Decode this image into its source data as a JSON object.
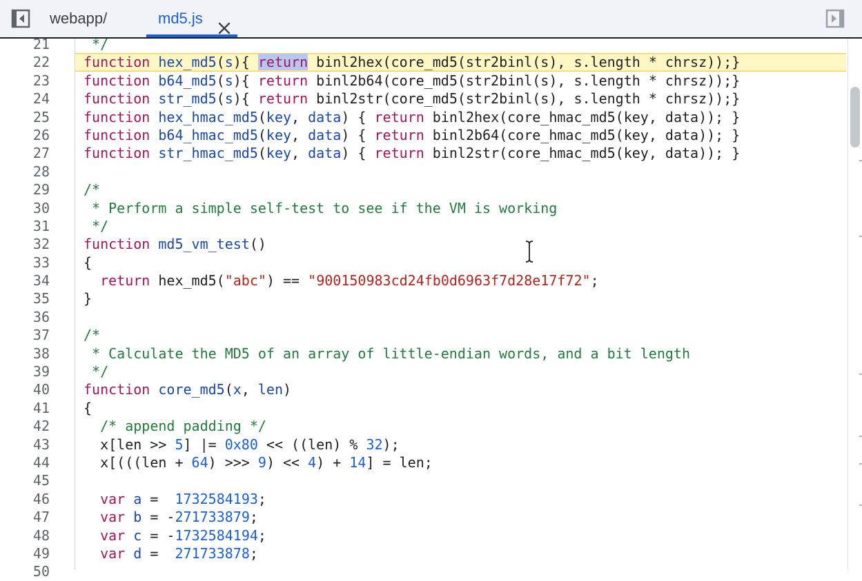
{
  "tabs": [
    {
      "label": "webapp/",
      "active": false
    },
    {
      "label": "md5.js",
      "active": true
    }
  ],
  "icons": {
    "left_toggle": "panel-left-collapse-icon",
    "right_toggle": "panel-right-expand-icon",
    "tab_close": "close-icon",
    "cursor": "text-cursor-icon"
  },
  "colors": {
    "keyword": "#a3155b",
    "function_name": "#1a47a3",
    "comment": "#237a3e",
    "string": "#b3241b",
    "number": "#1a5fd6",
    "current_line_bg": "#fff8c5",
    "selection_bg": "#b7c7ef",
    "active_tab": "#1a5fd6"
  },
  "editor": {
    "current_line": 22,
    "lines": [
      {
        "n": "21",
        "tokens": [
          [
            " */",
            "c"
          ]
        ]
      },
      {
        "n": "22",
        "tokens": [
          [
            "function",
            "k"
          ],
          [
            " ",
            "p"
          ],
          [
            "hex_md5",
            "f"
          ],
          [
            "(",
            "p"
          ],
          [
            "s",
            "f"
          ],
          [
            "){ ",
            "p"
          ],
          [
            "return",
            "sel"
          ],
          [
            " binl2hex(core_md5(str2binl(s), s.length * chrsz));}",
            "p"
          ]
        ]
      },
      {
        "n": "23",
        "tokens": [
          [
            "function",
            "k"
          ],
          [
            " ",
            "p"
          ],
          [
            "b64_md5",
            "f"
          ],
          [
            "(",
            "p"
          ],
          [
            "s",
            "f"
          ],
          [
            "){ ",
            "p"
          ],
          [
            "return",
            "k"
          ],
          [
            " binl2b64(core_md5(str2binl(s), s.length * chrsz));}",
            "p"
          ]
        ]
      },
      {
        "n": "24",
        "tokens": [
          [
            "function",
            "k"
          ],
          [
            " ",
            "p"
          ],
          [
            "str_md5",
            "f"
          ],
          [
            "(",
            "p"
          ],
          [
            "s",
            "f"
          ],
          [
            "){ ",
            "p"
          ],
          [
            "return",
            "k"
          ],
          [
            " binl2str(core_md5(str2binl(s), s.length * chrsz));}",
            "p"
          ]
        ]
      },
      {
        "n": "25",
        "tokens": [
          [
            "function",
            "k"
          ],
          [
            " ",
            "p"
          ],
          [
            "hex_hmac_md5",
            "f"
          ],
          [
            "(",
            "p"
          ],
          [
            "key",
            "f"
          ],
          [
            ", ",
            "p"
          ],
          [
            "data",
            "f"
          ],
          [
            ") { ",
            "p"
          ],
          [
            "return",
            "k"
          ],
          [
            " binl2hex(core_hmac_md5(key, data)); }",
            "p"
          ]
        ]
      },
      {
        "n": "26",
        "tokens": [
          [
            "function",
            "k"
          ],
          [
            " ",
            "p"
          ],
          [
            "b64_hmac_md5",
            "f"
          ],
          [
            "(",
            "p"
          ],
          [
            "key",
            "f"
          ],
          [
            ", ",
            "p"
          ],
          [
            "data",
            "f"
          ],
          [
            ") { ",
            "p"
          ],
          [
            "return",
            "k"
          ],
          [
            " binl2b64(core_hmac_md5(key, data)); }",
            "p"
          ]
        ]
      },
      {
        "n": "27",
        "tokens": [
          [
            "function",
            "k"
          ],
          [
            " ",
            "p"
          ],
          [
            "str_hmac_md5",
            "f"
          ],
          [
            "(",
            "p"
          ],
          [
            "key",
            "f"
          ],
          [
            ", ",
            "p"
          ],
          [
            "data",
            "f"
          ],
          [
            ") { ",
            "p"
          ],
          [
            "return",
            "k"
          ],
          [
            " binl2str(core_hmac_md5(key, data)); }",
            "p"
          ]
        ]
      },
      {
        "n": "28",
        "tokens": []
      },
      {
        "n": "29",
        "tokens": [
          [
            "/*",
            "c"
          ]
        ]
      },
      {
        "n": "30",
        "tokens": [
          [
            " * Perform a simple self-test to see if the VM is working",
            "c"
          ]
        ]
      },
      {
        "n": "31",
        "tokens": [
          [
            " */",
            "c"
          ]
        ]
      },
      {
        "n": "32",
        "tokens": [
          [
            "function",
            "k"
          ],
          [
            " ",
            "p"
          ],
          [
            "md5_vm_test",
            "f"
          ],
          [
            "()",
            "p"
          ]
        ]
      },
      {
        "n": "33",
        "tokens": [
          [
            "{",
            "p"
          ]
        ]
      },
      {
        "n": "34",
        "tokens": [
          [
            "  ",
            "p"
          ],
          [
            "return",
            "k"
          ],
          [
            " hex_md5(",
            "p"
          ],
          [
            "\"abc\"",
            "s"
          ],
          [
            ") == ",
            "p"
          ],
          [
            "\"900150983cd24fb0d6963f7d28e17f72\"",
            "s"
          ],
          [
            ";",
            "p"
          ]
        ]
      },
      {
        "n": "35",
        "tokens": [
          [
            "}",
            "p"
          ]
        ]
      },
      {
        "n": "36",
        "tokens": []
      },
      {
        "n": "37",
        "tokens": [
          [
            "/*",
            "c"
          ]
        ]
      },
      {
        "n": "38",
        "tokens": [
          [
            " * Calculate the MD5 of an array of little-endian words, and a bit length",
            "c"
          ]
        ]
      },
      {
        "n": "39",
        "tokens": [
          [
            " */",
            "c"
          ]
        ]
      },
      {
        "n": "40",
        "tokens": [
          [
            "function",
            "k"
          ],
          [
            " ",
            "p"
          ],
          [
            "core_md5",
            "f"
          ],
          [
            "(",
            "p"
          ],
          [
            "x",
            "f"
          ],
          [
            ", ",
            "p"
          ],
          [
            "len",
            "f"
          ],
          [
            ")",
            "p"
          ]
        ]
      },
      {
        "n": "41",
        "tokens": [
          [
            "{",
            "p"
          ]
        ]
      },
      {
        "n": "42",
        "tokens": [
          [
            "  ",
            "p"
          ],
          [
            "/* append padding */",
            "c"
          ]
        ]
      },
      {
        "n": "43",
        "tokens": [
          [
            "  x[len >> ",
            "p"
          ],
          [
            "5",
            "n"
          ],
          [
            "] |= ",
            "p"
          ],
          [
            "0x80",
            "n"
          ],
          [
            " << ((len) % ",
            "p"
          ],
          [
            "32",
            "n"
          ],
          [
            ");",
            "p"
          ]
        ]
      },
      {
        "n": "44",
        "tokens": [
          [
            "  x[(((len + ",
            "p"
          ],
          [
            "64",
            "n"
          ],
          [
            ") >>> ",
            "p"
          ],
          [
            "9",
            "n"
          ],
          [
            ") << ",
            "p"
          ],
          [
            "4",
            "n"
          ],
          [
            ") + ",
            "p"
          ],
          [
            "14",
            "n"
          ],
          [
            "] = len;",
            "p"
          ]
        ]
      },
      {
        "n": "45",
        "tokens": []
      },
      {
        "n": "46",
        "tokens": [
          [
            "  ",
            "p"
          ],
          [
            "var",
            "k"
          ],
          [
            " ",
            "p"
          ],
          [
            "a",
            "f"
          ],
          [
            " =  ",
            "p"
          ],
          [
            "1732584193",
            "n"
          ],
          [
            ";",
            "p"
          ]
        ]
      },
      {
        "n": "47",
        "tokens": [
          [
            "  ",
            "p"
          ],
          [
            "var",
            "k"
          ],
          [
            " ",
            "p"
          ],
          [
            "b",
            "f"
          ],
          [
            " = -",
            "p"
          ],
          [
            "271733879",
            "n"
          ],
          [
            ";",
            "p"
          ]
        ]
      },
      {
        "n": "48",
        "tokens": [
          [
            "  ",
            "p"
          ],
          [
            "var",
            "k"
          ],
          [
            " ",
            "p"
          ],
          [
            "c",
            "f"
          ],
          [
            " = -",
            "p"
          ],
          [
            "1732584194",
            "n"
          ],
          [
            ";",
            "p"
          ]
        ]
      },
      {
        "n": "49",
        "tokens": [
          [
            "  ",
            "p"
          ],
          [
            "var",
            "k"
          ],
          [
            " ",
            "p"
          ],
          [
            "d",
            "f"
          ],
          [
            " =  ",
            "p"
          ],
          [
            "271733878",
            "n"
          ],
          [
            ";",
            "p"
          ]
        ]
      },
      {
        "n": "50",
        "tokens": []
      }
    ]
  }
}
